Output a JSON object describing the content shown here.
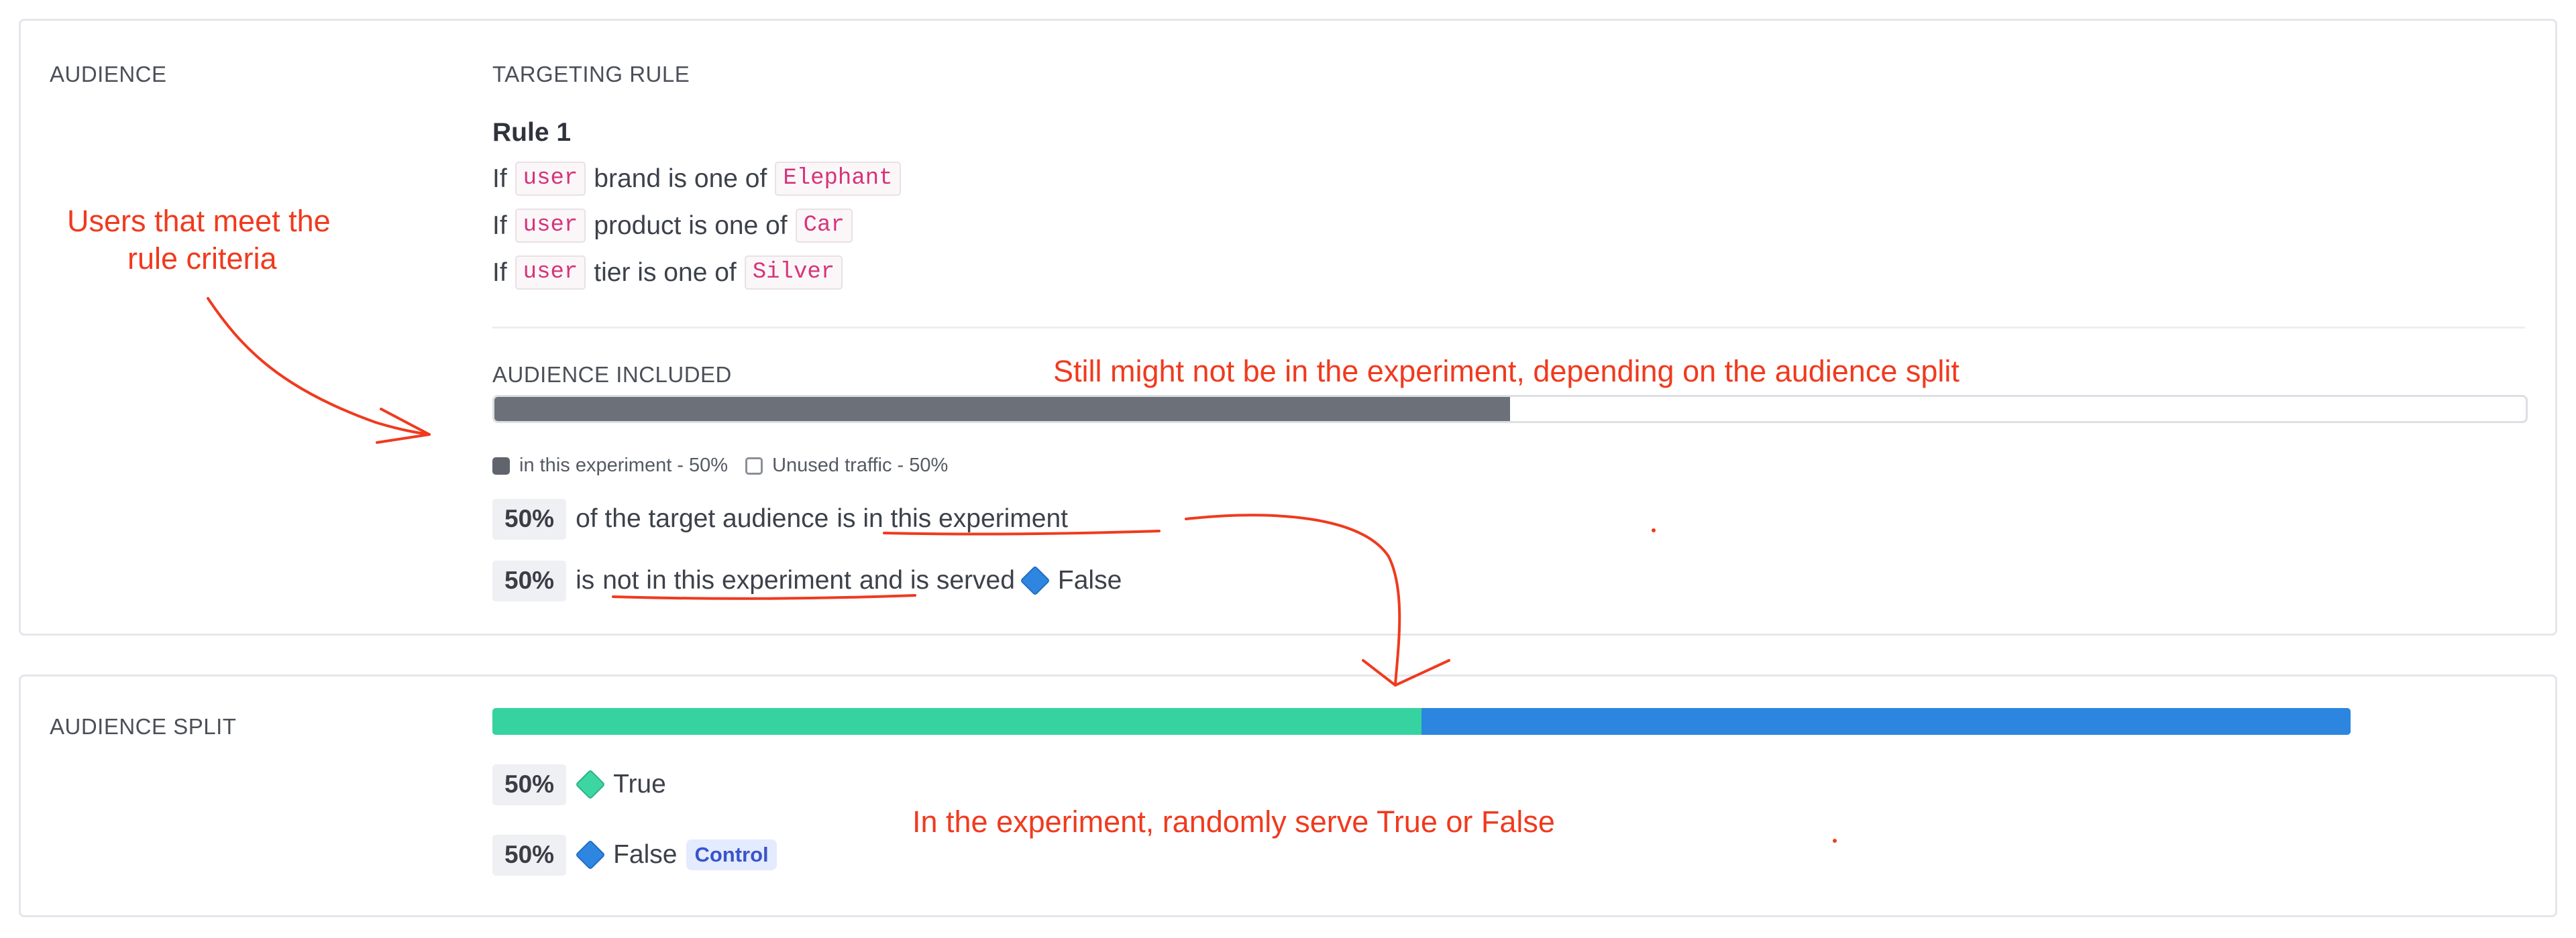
{
  "audience": {
    "section_label": "AUDIENCE",
    "targeting_label": "TARGETING RULE",
    "rule_title": "Rule 1",
    "conditions": [
      {
        "prefix": "If",
        "entity": "user",
        "text": "brand is one of",
        "value": "Elephant"
      },
      {
        "prefix": "If",
        "entity": "user",
        "text": "product is one of",
        "value": "Car"
      },
      {
        "prefix": "If",
        "entity": "user",
        "text": "tier is one of",
        "value": "Silver"
      }
    ],
    "included_label": "AUDIENCE INCLUDED",
    "included_fraction": 0.5,
    "legend": {
      "in_experiment": "in this experiment - 50%",
      "unused": "Unused traffic - 50%"
    },
    "in_row": {
      "pct": "50%",
      "text_a": "of the target audience",
      "text_b": "is in this experiment"
    },
    "out_row": {
      "pct": "50%",
      "text_a": "is",
      "text_b": "not in this experiment",
      "text_c": "and is served",
      "variation": "False"
    }
  },
  "split": {
    "section_label": "AUDIENCE SPLIT",
    "bar_fractions": [
      0.5,
      0.5
    ],
    "rows": [
      {
        "pct": "50%",
        "variation": "True"
      },
      {
        "pct": "50%",
        "variation": "False",
        "badge": "Control"
      }
    ]
  },
  "annotations": {
    "users_meet_line1": "Users that meet the",
    "users_meet_line2": "rule criteria",
    "still_might": "Still might not be in the experiment, depending on the audience split",
    "randomly_serve": "In the experiment, randomly serve True or False"
  },
  "colors": {
    "included_bar": "#6b7079",
    "true_variation": "#36d3a0",
    "false_variation": "#2c86df",
    "annotation": "#f03a1e"
  },
  "icons": {
    "true_variation": "green-diamond-icon",
    "false_variation": "blue-diamond-icon"
  }
}
